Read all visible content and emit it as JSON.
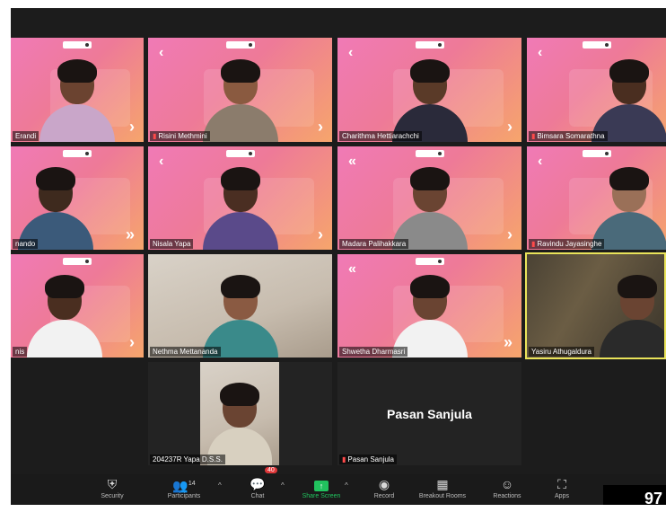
{
  "participants": [
    {
      "id": "erandi",
      "name": "Erandi",
      "style": "pink",
      "skin": "#6b4330",
      "shirt": "#c9a6c9"
    },
    {
      "id": "risini",
      "name": "Risini Methmini",
      "style": "pink",
      "skin": "#8a5a40",
      "shirt": "#8b7c6c"
    },
    {
      "id": "charithma",
      "name": "Charithma Hettiarachchi",
      "style": "pink",
      "skin": "#5a3a28",
      "shirt": "#2a2a3a"
    },
    {
      "id": "bimsara",
      "name": "Bimsara Somarathna",
      "style": "pink",
      "skin": "#4a2e20",
      "shirt": "#3a3a55"
    },
    {
      "id": "nando",
      "name": "nando",
      "style": "pink",
      "skin": "#3e2a1e",
      "shirt": "#3b5a7a"
    },
    {
      "id": "nisala",
      "name": "Nisala Yapa",
      "style": "pink",
      "skin": "#4a2e22",
      "shirt": "#5a4a8a"
    },
    {
      "id": "madara",
      "name": "Madara Palihakkara",
      "style": "pink",
      "skin": "#6a4432",
      "shirt": "#8a8a8a"
    },
    {
      "id": "ravindu",
      "name": "Ravindu Jayasinghe",
      "style": "pink",
      "skin": "#9a7058",
      "shirt": "#4a6a7a"
    },
    {
      "id": "nis",
      "name": "nis",
      "style": "pink",
      "skin": "#4a2e20",
      "shirt": "#f2f2f2"
    },
    {
      "id": "nethma",
      "name": "Nethma Mettananda",
      "style": "room",
      "skin": "#8a5a42",
      "shirt": "#3a8a8a"
    },
    {
      "id": "shwetha",
      "name": "Shwetha Dharmasri",
      "style": "pink",
      "skin": "#6a4432",
      "shirt": "#f2f2f2"
    },
    {
      "id": "yasiru",
      "name": "Yasiru Athugaldura",
      "style": "brick",
      "skin": "#6a4432",
      "shirt": "#2a2a2a"
    },
    {
      "id": "yapa",
      "name": "204237R Yapa D.S.S.",
      "style": "room",
      "skin": "#6a4432",
      "shirt": "#d8d0c0"
    },
    {
      "id": "pasan",
      "name": "Pasan Sanjula",
      "style": "dark",
      "display_name": "Pasan Sanjula"
    }
  ],
  "toolbar": {
    "security": "Security",
    "participants": "Participants",
    "participants_count": "14",
    "chat": "Chat",
    "chat_badge": "40",
    "share_screen": "Share Screen",
    "record": "Record",
    "breakout": "Breakout Rooms",
    "reactions": "Reactions",
    "apps": "Apps",
    "colors": {
      "share": "#21c25e",
      "badge": "#e0383a"
    }
  },
  "corner_label": "97"
}
